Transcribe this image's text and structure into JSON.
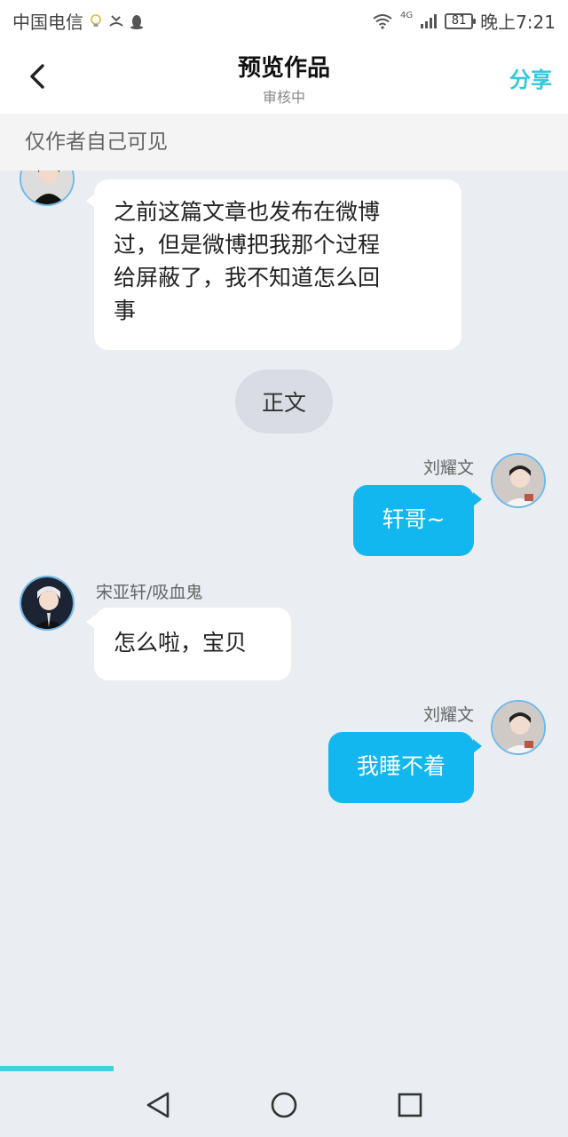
{
  "status_bar": {
    "carrier": "中国电信",
    "network": "4G",
    "battery": "81",
    "time": "晚上7:21"
  },
  "header": {
    "title": "预览作品",
    "subtitle": "审核中",
    "share_label": "分享"
  },
  "notice": "仅作者自己可见",
  "messages": [
    {
      "side": "left",
      "sender": "",
      "text": "之前这篇文章也发布在微博过，但是微博把我那个过程给屏蔽了，我不知道怎么回事",
      "lines": [
        "之前这篇文章也发布在微博",
        "过，但是微博把我那个过程",
        "给屏蔽了，我不知道怎么回",
        "事"
      ]
    },
    {
      "side": "right",
      "sender": "刘耀文",
      "text": "轩哥~"
    },
    {
      "side": "left",
      "sender": "宋亚轩/吸血鬼",
      "text": "怎么啦，宝贝"
    },
    {
      "side": "right",
      "sender": "刘耀文",
      "text": "我睡不着"
    }
  ],
  "section_label": "正文",
  "progress": 0.2,
  "colors": {
    "accent": "#34c6dc",
    "out_bubble": "#11b7ee",
    "background": "#eaedf1"
  },
  "icons": [
    "back-arrow-icon",
    "wifi-icon",
    "signal-icon",
    "battery-icon",
    "back-nav-icon",
    "home-nav-icon",
    "recents-nav-icon"
  ]
}
